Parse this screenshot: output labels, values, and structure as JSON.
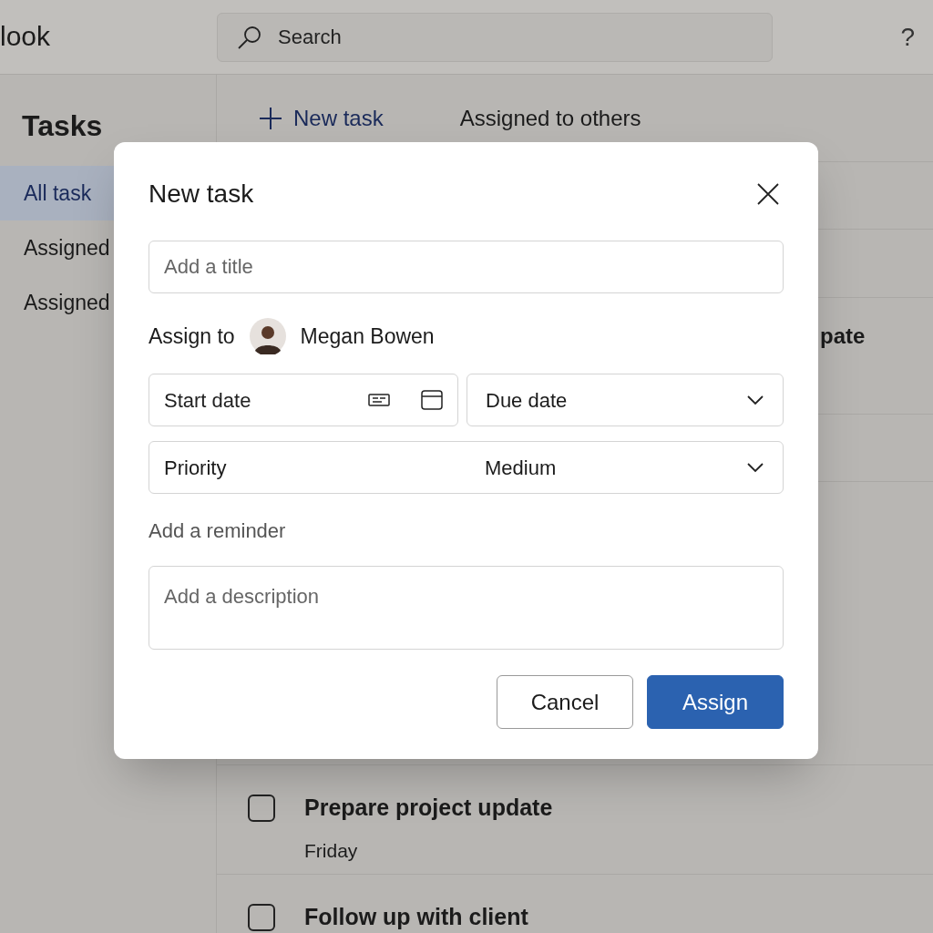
{
  "app": {
    "title": "look"
  },
  "search": {
    "placeholder": "Search"
  },
  "help": "?",
  "sidebar": {
    "title": "Tasks",
    "items": [
      {
        "label": "All task",
        "selected": true
      },
      {
        "label": "Assigned",
        "selected": false
      },
      {
        "label": "Assigned",
        "selected": false
      }
    ]
  },
  "toolbar": {
    "new_task": "New task",
    "assigned_to_others": "Assigned to others"
  },
  "covered_text": "pate",
  "tasks": [
    {
      "title": "Prepare project update",
      "due": "Friday",
      "checked": false
    },
    {
      "title": "Follow up with client",
      "checked": false
    }
  ],
  "dialog": {
    "title": "New task",
    "title_field": {
      "placeholder": "Add a title"
    },
    "assign_label": "Assign to",
    "assignee": "Megan Bowen",
    "start_date": {
      "placeholder": "Start date"
    },
    "due_date": {
      "placeholder": "Due date"
    },
    "priority": {
      "label": "Priority",
      "value": "Medium"
    },
    "reminder": "Add a reminder",
    "description": {
      "placeholder": "Add a description"
    },
    "buttons": [
      {
        "label": "Cancel",
        "kind": "secondary"
      },
      {
        "label": "Assign",
        "kind": "primary"
      }
    ]
  }
}
